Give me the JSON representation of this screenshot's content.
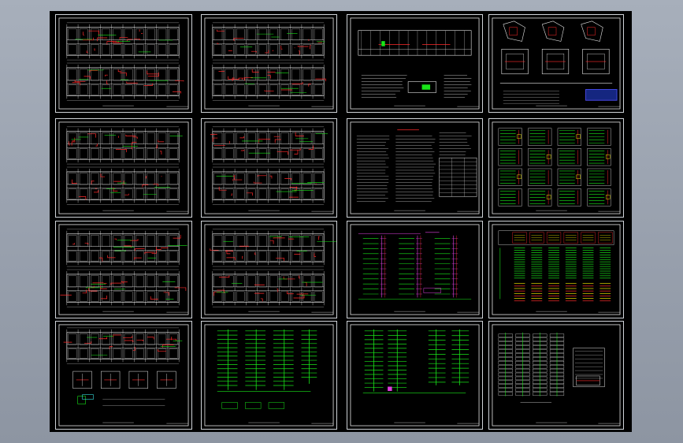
{
  "window": {
    "title": ""
  },
  "colors": {
    "background": "#98a0ad",
    "canvas": "#000000",
    "line_white": "#e8e8e8",
    "line_red": "#ff2a2a",
    "line_green": "#19e619",
    "line_yellow": "#f2e600",
    "line_cyan": "#38e0e0",
    "line_magenta": "#e040e0",
    "line_blue": "#2a4cff"
  },
  "sheets": [
    {
      "id": "s1",
      "type": "floorplan-double",
      "col": 0,
      "row": 0
    },
    {
      "id": "s2",
      "type": "floorplan-double",
      "col": 1,
      "row": 0
    },
    {
      "id": "s3",
      "type": "section-notes",
      "col": 2,
      "row": 0
    },
    {
      "id": "s4",
      "type": "details-grid",
      "col": 3,
      "row": 0
    },
    {
      "id": "s5",
      "type": "floorplan-double",
      "col": 0,
      "row": 1
    },
    {
      "id": "s6",
      "type": "floorplan-double",
      "col": 1,
      "row": 1
    },
    {
      "id": "s7",
      "type": "notes-table",
      "col": 2,
      "row": 1
    },
    {
      "id": "s8",
      "type": "panel-schedules",
      "col": 3,
      "row": 1
    },
    {
      "id": "s9",
      "type": "floorplan-double",
      "col": 0,
      "row": 2
    },
    {
      "id": "s10",
      "type": "floorplan-double",
      "col": 1,
      "row": 2
    },
    {
      "id": "s11",
      "type": "riser",
      "col": 2,
      "row": 2
    },
    {
      "id": "s12",
      "type": "distribution-grid",
      "col": 3,
      "row": 2
    },
    {
      "id": "s13",
      "type": "floorplan-detail",
      "col": 0,
      "row": 3
    },
    {
      "id": "s14",
      "type": "system-green",
      "col": 1,
      "row": 3
    },
    {
      "id": "s15",
      "type": "system-green-2",
      "col": 2,
      "row": 3
    },
    {
      "id": "s16",
      "type": "elevation",
      "col": 3,
      "row": 3
    }
  ]
}
